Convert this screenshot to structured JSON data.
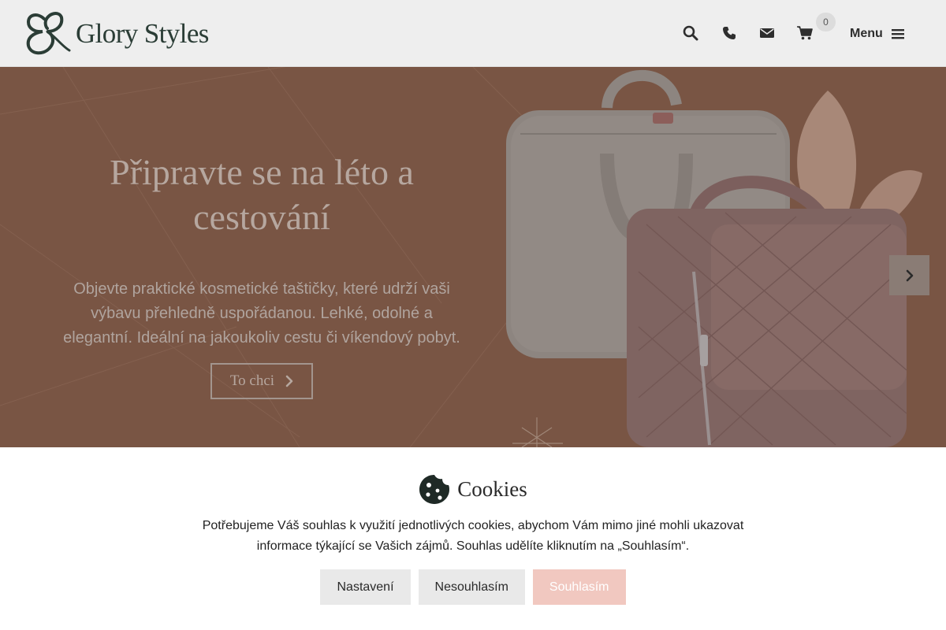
{
  "header": {
    "logo_text": "Glory Styles",
    "icons": [
      "search-icon",
      "phone-icon",
      "envelope-icon",
      "cart-icon",
      "hamburger-icon"
    ],
    "cart_count": "0",
    "menu_label": "Menu"
  },
  "hero": {
    "title": "Připravte se na léto a cestování",
    "description": "Objevte praktické kosmetické taštičky, které udrží vaši výbavu přehledně uspořádanou. Lehké, odolné a elegantní. Ideální na jakoukoliv cestu či víkendový pobyt.",
    "cta_label": "To chci",
    "next_icon": "chevron-right-icon"
  },
  "cookies": {
    "icon": "cookie-icon",
    "title": "Cookies",
    "text": "Potřebujeme Váš souhlas k využití jednotlivých cookies, abychom Vám mimo jiné mohli ukazovat informace týkající se Vašich zájmů. Souhlas udělíte kliknutím na „Souhlasím“.",
    "buttons": {
      "settings": "Nastavení",
      "decline": "Nesouhlasím",
      "accept": "Souhlasím"
    }
  },
  "colors": {
    "brand": "#2b3d36",
    "hero_background": "#795544",
    "accept_button": "#f1c8c0",
    "secondary_button": "#e9e9e9"
  }
}
